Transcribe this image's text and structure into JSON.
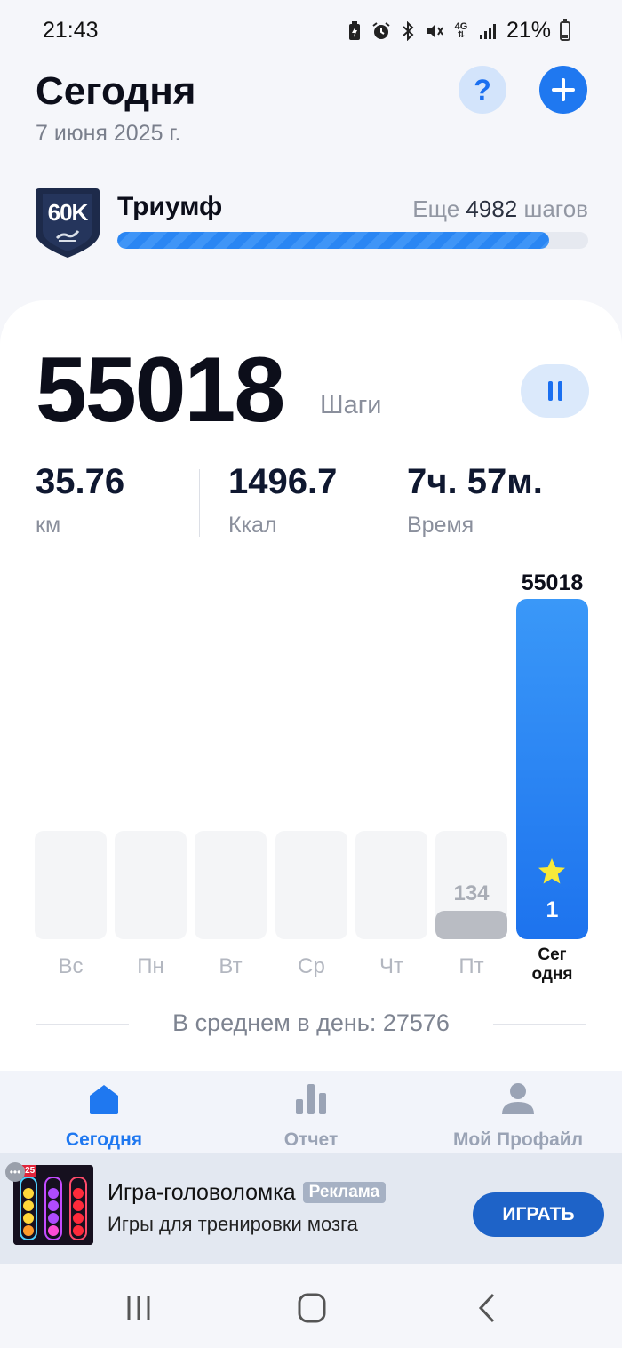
{
  "status_bar": {
    "time": "21:43",
    "icons": [
      "battery-saver-icon",
      "alarm-icon",
      "bluetooth-icon",
      "mute-icon",
      "4g-icon",
      "signal-icon"
    ],
    "network": "4G",
    "battery": "21%"
  },
  "header": {
    "title": "Сегодня",
    "date": "7 июня 2025 г.",
    "help_icon": "?"
  },
  "achievement": {
    "badge_text": "60K",
    "name": "Триумф",
    "remaining_prefix": "Еще",
    "remaining_value": "4982",
    "remaining_suffix": "шагов",
    "progress": 0.917
  },
  "today": {
    "steps": "55018",
    "steps_label": "Шаги",
    "stats": [
      {
        "value": "35.76",
        "label": "км"
      },
      {
        "value": "1496.7",
        "label": "Ккал"
      },
      {
        "value": "7ч. 57м.",
        "label": "Время"
      }
    ]
  },
  "chart_data": {
    "type": "bar",
    "categories": [
      "Вс",
      "Пн",
      "Вт",
      "Ср",
      "Чт",
      "Пт",
      "Сег одня"
    ],
    "values": [
      0,
      0,
      0,
      0,
      0,
      134,
      55018
    ],
    "today_label_line1": "Сег",
    "today_label_line2": "одня",
    "today_value_label": "55018",
    "friday_value_label": "134",
    "today_goal_count": "1",
    "colors": {
      "today": "#1f78f0",
      "past": "#b9bcc3",
      "empty": "#f4f5f7"
    }
  },
  "average": {
    "text": "В среднем в день: 27576"
  },
  "bottom_nav": {
    "items": [
      {
        "label": "Сегодня",
        "active": true
      },
      {
        "label": "Отчет",
        "active": false
      },
      {
        "label": "Мой Профайл",
        "active": false
      }
    ],
    "active_color": "#1f78f0",
    "inactive_color": "#9aa3b5"
  },
  "ad": {
    "title": "Игра-головоломка",
    "badge": "Реклама",
    "subtitle": "Игры для тренировки мозга",
    "button": "ИГРАТЬ",
    "thumb_label": "2025"
  },
  "colors": {
    "accent": "#1f78f0",
    "text_dark": "#0c0e1a",
    "text_muted": "#8a8f9c"
  }
}
